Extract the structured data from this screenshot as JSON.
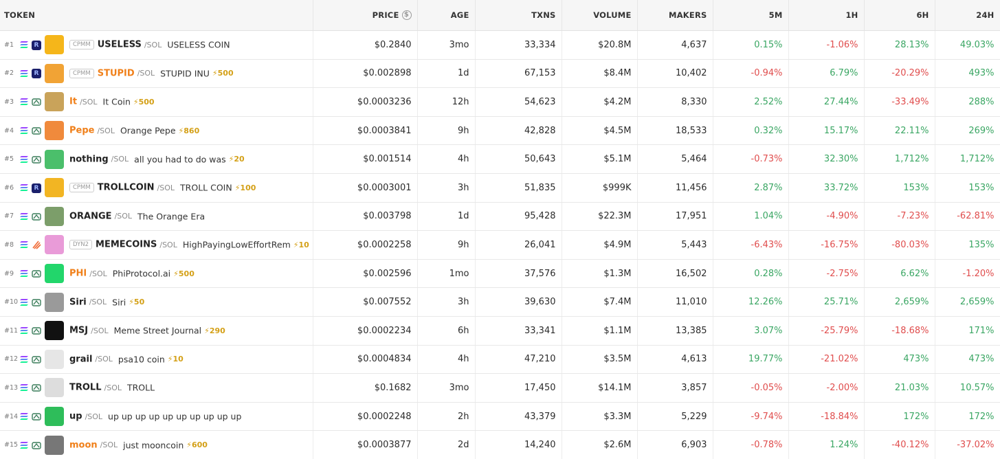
{
  "headers": {
    "token": "TOKEN",
    "price": "PRICE",
    "age": "AGE",
    "txns": "TXNS",
    "volume": "VOLUME",
    "makers": "MAKERS",
    "m5": "5M",
    "h1": "1H",
    "h6": "6H",
    "h24": "24H"
  },
  "colors": {
    "positive": "#3aa663",
    "negative": "#e04d4d",
    "highlight_symbol": "#f0801a",
    "boost": "#d4a017"
  },
  "rows": [
    {
      "rank": "#1",
      "dex_icon": "raydium-icon",
      "avatar_icon": "useless-coin-avatar",
      "avatar_color": "#f5b61a",
      "pool": "CPMM",
      "symbol": "USELESS",
      "orange": false,
      "quote": "/SOL",
      "name": "USELESS COIN",
      "boost": "",
      "price": "$0.2840",
      "age": "3mo",
      "txns": "33,334",
      "volume": "$20.8M",
      "makers": "4,637",
      "m5": "0.15%",
      "h1": "-1.06%",
      "h6": "28.13%",
      "h24": "49.03%"
    },
    {
      "rank": "#2",
      "dex_icon": "raydium-icon",
      "avatar_icon": "stupid-inu-avatar",
      "avatar_color": "#f1a335",
      "pool": "CPMM",
      "symbol": "STUPID",
      "orange": true,
      "quote": "/SOL",
      "name": "STUPID INU",
      "boost": "⚡500",
      "price": "$0.002898",
      "age": "1d",
      "txns": "67,153",
      "volume": "$8.4M",
      "makers": "10,402",
      "m5": "-0.94%",
      "h1": "6.79%",
      "h6": "-20.29%",
      "h24": "493%"
    },
    {
      "rank": "#3",
      "dex_icon": "pumpswap-icon",
      "avatar_icon": "it-coin-avatar",
      "avatar_color": "#c9a35a",
      "pool": "",
      "symbol": "It",
      "orange": true,
      "quote": "/SOL",
      "name": "It Coin",
      "boost": "⚡500",
      "price": "$0.0003236",
      "age": "12h",
      "txns": "54,623",
      "volume": "$4.2M",
      "makers": "8,330",
      "m5": "2.52%",
      "h1": "27.44%",
      "h6": "-33.49%",
      "h24": "288%"
    },
    {
      "rank": "#4",
      "dex_icon": "pumpswap-icon",
      "avatar_icon": "pepe-avatar",
      "avatar_color": "#f08a3c",
      "pool": "",
      "symbol": "Pepe",
      "orange": true,
      "quote": "/SOL",
      "name": "Orange Pepe",
      "boost": "⚡860",
      "price": "$0.0003841",
      "age": "9h",
      "txns": "42,828",
      "volume": "$4.5M",
      "makers": "18,533",
      "m5": "0.32%",
      "h1": "15.17%",
      "h6": "22.11%",
      "h24": "269%"
    },
    {
      "rank": "#5",
      "dex_icon": "pumpswap-icon",
      "avatar_icon": "nothing-avatar",
      "avatar_color": "#4bbf6b",
      "pool": "",
      "symbol": "nothing",
      "orange": false,
      "quote": "/SOL",
      "name": "all you had to do was",
      "boost": "⚡20",
      "price": "$0.001514",
      "age": "4h",
      "txns": "50,643",
      "volume": "$5.1M",
      "makers": "5,464",
      "m5": "-0.73%",
      "h1": "32.30%",
      "h6": "1,712%",
      "h24": "1,712%"
    },
    {
      "rank": "#6",
      "dex_icon": "raydium-icon",
      "avatar_icon": "trollcoin-avatar",
      "avatar_color": "#f2b523",
      "pool": "CPMM",
      "symbol": "TROLLCOIN",
      "orange": false,
      "quote": "/SOL",
      "name": "TROLL COIN",
      "boost": "⚡100",
      "price": "$0.0003001",
      "age": "3h",
      "txns": "51,835",
      "volume": "$999K",
      "makers": "11,456",
      "m5": "2.87%",
      "h1": "33.72%",
      "h6": "153%",
      "h24": "153%"
    },
    {
      "rank": "#7",
      "dex_icon": "pumpswap-icon",
      "avatar_icon": "orange-avatar",
      "avatar_color": "#7c9e6a",
      "pool": "",
      "symbol": "ORANGE",
      "orange": false,
      "quote": "/SOL",
      "name": "The Orange Era",
      "boost": "",
      "price": "$0.003798",
      "age": "1d",
      "txns": "95,428",
      "volume": "$22.3M",
      "makers": "17,951",
      "m5": "1.04%",
      "h1": "-4.90%",
      "h6": "-7.23%",
      "h24": "-62.81%"
    },
    {
      "rank": "#8",
      "dex_icon": "meteora-icon",
      "avatar_icon": "memecoins-avatar",
      "avatar_color": "#e99bd8",
      "pool": "DYN2",
      "symbol": "MEMECOINS",
      "orange": false,
      "quote": "/SOL",
      "name": "HighPayingLowEffortRem",
      "boost": "⚡10",
      "price": "$0.0002258",
      "age": "9h",
      "txns": "26,041",
      "volume": "$4.9M",
      "makers": "5,443",
      "m5": "-6.43%",
      "h1": "-16.75%",
      "h6": "-80.03%",
      "h24": "135%"
    },
    {
      "rank": "#9",
      "dex_icon": "pumpswap-icon",
      "avatar_icon": "phi-avatar",
      "avatar_color": "#22d66b",
      "pool": "",
      "symbol": "PHI",
      "orange": true,
      "quote": "/SOL",
      "name": "PhiProtocol.ai",
      "boost": "⚡500",
      "price": "$0.002596",
      "age": "1mo",
      "txns": "37,576",
      "volume": "$1.3M",
      "makers": "16,502",
      "m5": "0.28%",
      "h1": "-2.75%",
      "h6": "6.62%",
      "h24": "-1.20%"
    },
    {
      "rank": "#10",
      "dex_icon": "pumpswap-icon",
      "avatar_icon": "siri-avatar",
      "avatar_color": "#9a9a9a",
      "pool": "",
      "symbol": "Siri",
      "orange": false,
      "quote": "/SOL",
      "name": "Siri",
      "boost": "⚡50",
      "price": "$0.007552",
      "age": "3h",
      "txns": "39,630",
      "volume": "$7.4M",
      "makers": "11,010",
      "m5": "12.26%",
      "h1": "25.71%",
      "h6": "2,659%",
      "h24": "2,659%"
    },
    {
      "rank": "#11",
      "dex_icon": "pumpswap-icon",
      "avatar_icon": "msj-avatar",
      "avatar_color": "#111111",
      "pool": "",
      "symbol": "MSJ",
      "orange": false,
      "quote": "/SOL",
      "name": "Meme Street Journal",
      "boost": "⚡290",
      "price": "$0.0002234",
      "age": "6h",
      "txns": "33,341",
      "volume": "$1.1M",
      "makers": "13,385",
      "m5": "3.07%",
      "h1": "-25.79%",
      "h6": "-18.68%",
      "h24": "171%"
    },
    {
      "rank": "#12",
      "dex_icon": "pumpswap-icon",
      "avatar_icon": "grail-avatar",
      "avatar_color": "#e6e6e6",
      "pool": "",
      "symbol": "grail",
      "orange": false,
      "quote": "/SOL",
      "name": "psa10 coin",
      "boost": "⚡10",
      "price": "$0.0004834",
      "age": "4h",
      "txns": "47,210",
      "volume": "$3.5M",
      "makers": "4,613",
      "m5": "19.77%",
      "h1": "-21.02%",
      "h6": "473%",
      "h24": "473%"
    },
    {
      "rank": "#13",
      "dex_icon": "pumpswap-icon",
      "avatar_icon": "troll-avatar",
      "avatar_color": "#dddddd",
      "pool": "",
      "symbol": "TROLL",
      "orange": false,
      "quote": "/SOL",
      "name": "TROLL",
      "boost": "",
      "price": "$0.1682",
      "age": "3mo",
      "txns": "17,450",
      "volume": "$14.1M",
      "makers": "3,857",
      "m5": "-0.05%",
      "h1": "-2.00%",
      "h6": "21.03%",
      "h24": "10.57%"
    },
    {
      "rank": "#14",
      "dex_icon": "pumpswap-icon",
      "avatar_icon": "up-avatar",
      "avatar_color": "#2ebd5a",
      "pool": "",
      "symbol": "up",
      "orange": false,
      "quote": "/SOL",
      "name": "up up up up up up up up up up",
      "boost": "",
      "price": "$0.0002248",
      "age": "2h",
      "txns": "43,379",
      "volume": "$3.3M",
      "makers": "5,229",
      "m5": "-9.74%",
      "h1": "-18.84%",
      "h6": "172%",
      "h24": "172%"
    },
    {
      "rank": "#15",
      "dex_icon": "pumpswap-icon",
      "avatar_icon": "moon-avatar",
      "avatar_color": "#777777",
      "pool": "",
      "symbol": "moon",
      "orange": true,
      "quote": "/SOL",
      "name": "just mooncoin",
      "boost": "⚡600",
      "price": "$0.0003877",
      "age": "2d",
      "txns": "14,240",
      "volume": "$2.6M",
      "makers": "6,903",
      "m5": "-0.78%",
      "h1": "1.24%",
      "h6": "-40.12%",
      "h24": "-37.02%"
    }
  ]
}
